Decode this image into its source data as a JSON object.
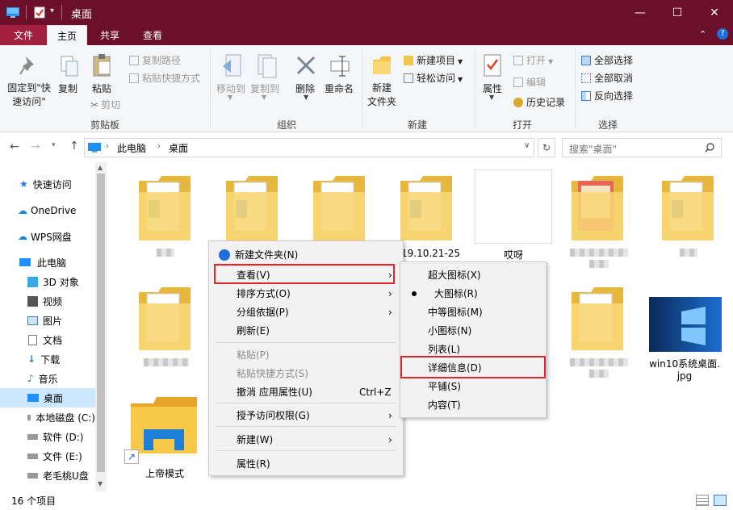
{
  "window": {
    "title": "桌面",
    "minimize": "—",
    "maximize": "☐",
    "close": "✕"
  },
  "tabs": [
    "文件",
    "主页",
    "共享",
    "查看"
  ],
  "ribbon": {
    "pin_line1": "固定到\"快",
    "pin_line2": "速访问\"",
    "copy": "复制",
    "paste": "粘贴",
    "copy_path": "复制路径",
    "paste_shortcut": "粘贴快捷方式",
    "cut": "剪切",
    "move_to": "移动到",
    "copy_to": "复制到",
    "delete": "删除",
    "rename": "重命名",
    "new_folder_line1": "新建",
    "new_folder_line2": "文件夹",
    "new_item": "新建项目",
    "easy_access": "轻松访问",
    "properties": "属性",
    "open": "打开",
    "edit": "编辑",
    "history": "历史记录",
    "select_all": "全部选择",
    "select_none": "全部取消",
    "invert": "反向选择",
    "groups": {
      "clipboard": "剪贴板",
      "organize": "组织",
      "new": "新建",
      "open": "打开",
      "select": "选择"
    }
  },
  "address": {
    "path1": "此电脑",
    "path2": "桌面",
    "search_placeholder": "搜索\"桌面\""
  },
  "nav": {
    "items": [
      "快速访问",
      "OneDrive",
      "WPS网盘",
      "此电脑",
      "3D 对象",
      "视频",
      "图片",
      "文档",
      "下载",
      "音乐",
      "桌面",
      "本地磁盘 (C:)",
      "软件 (D:)",
      "文件 (E:)",
      "老毛桃U盘"
    ]
  },
  "files": {
    "f4_label": "19.10.21-25",
    "f5_label": "哎呀",
    "img_label_line1": "win10系统桌面.",
    "img_label_line2": "jpg",
    "shortcut_label": "上帝模式"
  },
  "context_menu": {
    "items": [
      "新建文件夹(N)",
      "查看(V)",
      "排序方式(O)",
      "分组依据(P)",
      "刷新(E)",
      "粘贴(P)",
      "粘贴快捷方式(S)",
      "撤消 应用属性(U)",
      "授予访问权限(G)",
      "新建(W)",
      "属性(R)"
    ],
    "undo_shortcut": "Ctrl+Z"
  },
  "view_submenu": {
    "items": [
      "超大图标(X)",
      "大图标(R)",
      "中等图标(M)",
      "小图标(N)",
      "列表(L)",
      "详细信息(D)",
      "平铺(S)",
      "内容(T)"
    ]
  },
  "status": {
    "count": "16 个项目"
  },
  "colors": {
    "titlebar": "#6b0f2a",
    "file_tab": "#a3213f",
    "highlight": "#e0262a",
    "selection": "#cce8ff"
  }
}
